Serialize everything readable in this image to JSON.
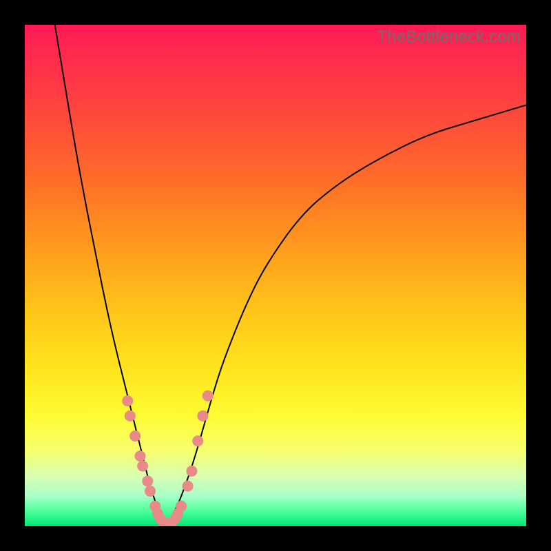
{
  "watermark": "TheBottleneck.com",
  "colors": {
    "gradient_top": "#ff1a55",
    "gradient_bottom": "#00e676",
    "curve": "#000000",
    "dots": "#e88a87",
    "frame": "#000000"
  },
  "chart_data": {
    "type": "line",
    "title": "",
    "xlabel": "",
    "ylabel": "",
    "xlim": [
      0,
      100
    ],
    "ylim": [
      0,
      100
    ],
    "grid": false,
    "legend": false,
    "series": [
      {
        "name": "left_branch",
        "x": [
          6,
          8,
          10,
          12,
          14,
          16,
          18,
          20,
          22,
          24,
          25,
          26,
          27,
          28
        ],
        "y": [
          100,
          88,
          76,
          65,
          55,
          45,
          36,
          28,
          20,
          12,
          8,
          5,
          2,
          0
        ]
      },
      {
        "name": "right_branch",
        "x": [
          28,
          30,
          32,
          34,
          36,
          38,
          40,
          44,
          48,
          55,
          62,
          70,
          80,
          90,
          100
        ],
        "y": [
          0,
          3,
          8,
          14,
          21,
          28,
          34,
          44,
          52,
          62,
          68,
          73,
          78,
          81,
          84
        ]
      }
    ],
    "markers": [
      {
        "x": 20.5,
        "y": 25
      },
      {
        "x": 21,
        "y": 22
      },
      {
        "x": 22,
        "y": 18
      },
      {
        "x": 23,
        "y": 14
      },
      {
        "x": 23.5,
        "y": 12
      },
      {
        "x": 24.5,
        "y": 9
      },
      {
        "x": 25,
        "y": 7
      },
      {
        "x": 26,
        "y": 4
      },
      {
        "x": 26.5,
        "y": 2.5
      },
      {
        "x": 27,
        "y": 1.5
      },
      {
        "x": 27.7,
        "y": 0.7
      },
      {
        "x": 28.5,
        "y": 0.5
      },
      {
        "x": 29.3,
        "y": 0.8
      },
      {
        "x": 30,
        "y": 1.5
      },
      {
        "x": 30.5,
        "y": 2.5
      },
      {
        "x": 31.2,
        "y": 4
      },
      {
        "x": 32.5,
        "y": 8
      },
      {
        "x": 33.3,
        "y": 11
      },
      {
        "x": 34.5,
        "y": 17
      },
      {
        "x": 35.5,
        "y": 22
      },
      {
        "x": 36.5,
        "y": 26
      }
    ],
    "marker_radius_px": 8,
    "annotations": []
  }
}
